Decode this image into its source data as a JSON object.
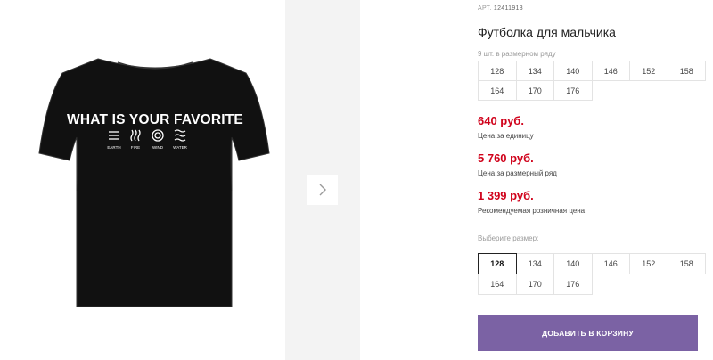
{
  "product": {
    "sku_label": "АРТ.",
    "sku_value": "12411913",
    "title": "Футболка для мальчика",
    "print_text": "WHAT IS YOUR FAVORITE",
    "elements": [
      "EARTH",
      "FIRE",
      "WIND",
      "WATER"
    ]
  },
  "size_row": {
    "note": "9 шт. в размерном ряду",
    "sizes": [
      "128",
      "134",
      "140",
      "146",
      "152",
      "158",
      "164",
      "170",
      "176"
    ]
  },
  "prices": [
    {
      "value": "640 руб.",
      "label": "Цена за единицу"
    },
    {
      "value": "5 760 руб.",
      "label": "Цена за размерный ряд"
    },
    {
      "value": "1 399 руб.",
      "label": "Рекомендуемая розничная цена"
    }
  ],
  "size_select": {
    "label": "Выберите размер:",
    "sizes": [
      "128",
      "134",
      "140",
      "146",
      "152",
      "158",
      "164",
      "170",
      "176"
    ],
    "selected": "128"
  },
  "cart": {
    "button_label": "ДОБАВИТЬ В КОРЗИНУ"
  },
  "colors": {
    "price": "#d0021b",
    "button": "#7b62a4",
    "shirt": "#111111"
  },
  "icons": {
    "next": "chevron-right-icon"
  }
}
